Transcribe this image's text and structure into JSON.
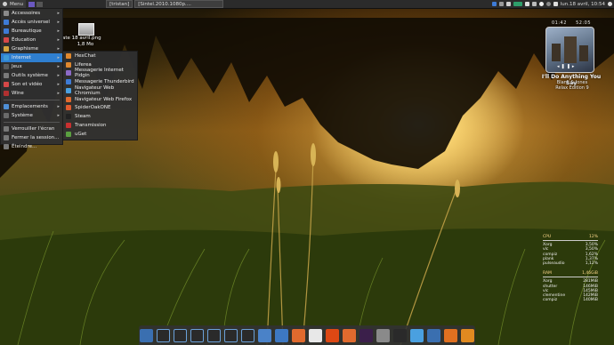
{
  "top_panel": {
    "menu_label": "Menu",
    "windows": [
      "[tristan]",
      "[Sintel.2010.1080p...."
    ],
    "clock": "lun.18 avril, 10:54"
  },
  "menu": {
    "categories": [
      {
        "label": "Accessoires",
        "icon": "accessories-icon",
        "color": "#8a8a8a"
      },
      {
        "label": "Accès universel",
        "icon": "accessibility-icon",
        "color": "#3e7bd6"
      },
      {
        "label": "Bureautique",
        "icon": "office-icon",
        "color": "#3e7bd6"
      },
      {
        "label": "Éducation",
        "icon": "education-icon",
        "color": "#d64848"
      },
      {
        "label": "Graphisme",
        "icon": "graphics-icon",
        "color": "#d6a63e"
      },
      {
        "label": "Internet",
        "icon": "internet-icon",
        "color": "#3e9bd6"
      },
      {
        "label": "Jeux",
        "icon": "games-icon",
        "color": "#5a5a5a"
      },
      {
        "label": "Outils système",
        "icon": "system-tools-icon",
        "color": "#7a7a7a"
      },
      {
        "label": "Son et vidéo",
        "icon": "multimedia-icon",
        "color": "#d64848"
      },
      {
        "label": "Wine",
        "icon": "wine-icon",
        "color": "#b03030"
      }
    ],
    "places": [
      {
        "label": "Emplacements",
        "icon": "places-icon",
        "color": "#4f8fd6"
      },
      {
        "label": "Système",
        "icon": "system-icon",
        "color": "#6a6a6a"
      }
    ],
    "actions": [
      {
        "label": "Verrouiller l'écran",
        "icon": "lock-icon"
      },
      {
        "label": "Fermer la session...",
        "icon": "logout-icon"
      },
      {
        "label": "Éteindre...",
        "icon": "power-icon"
      }
    ]
  },
  "submenu": {
    "items": [
      {
        "label": "HexChat",
        "icon": "hexchat-icon",
        "color": "#e0882e"
      },
      {
        "label": "Liferea",
        "icon": "liferea-icon",
        "color": "#e0882e"
      },
      {
        "label": "Messagerie Internet Pidgin",
        "icon": "pidgin-icon",
        "color": "#8c6ac8"
      },
      {
        "label": "Messagerie Thunderbird",
        "icon": "thunderbird-icon",
        "color": "#3e7bd6"
      },
      {
        "label": "Navigateur Web Chromium",
        "icon": "chromium-icon",
        "color": "#4aa0e0"
      },
      {
        "label": "Navigateur Web Firefox",
        "icon": "firefox-icon",
        "color": "#e06a2e"
      },
      {
        "label": "SpiderOakONE",
        "icon": "spideroak-icon",
        "color": "#e05a2e"
      },
      {
        "label": "Steam",
        "icon": "steam-icon",
        "color": "#222222"
      },
      {
        "label": "Transmission",
        "icon": "transmission-icon",
        "color": "#c83030"
      },
      {
        "label": "uGet",
        "icon": "uget-icon",
        "color": "#5aa040"
      }
    ]
  },
  "desktop": {
    "file_label": "ate 18 avril.png",
    "file_size": "1,8 Mo"
  },
  "media_widget": {
    "time_elapsed": "01:42",
    "time_total": "52:05",
    "track": "I'll Do Anything You Say",
    "artist_line1": "Blank & Jones",
    "artist_line2": "Relax Edition 9"
  },
  "conky": {
    "cpu_label": "CPU",
    "cpu_value": "12%",
    "cpu_procs": [
      {
        "name": "Xorg",
        "value": "3,50%"
      },
      {
        "name": "vlc",
        "value": "3,50%"
      },
      {
        "name": "compiz",
        "value": "1,62%"
      },
      {
        "name": "plank",
        "value": "1,37%"
      },
      {
        "name": "pulseaudio",
        "value": "1,12%"
      }
    ],
    "ram_label": "RAM",
    "ram_value": "1,46GiB",
    "ram_procs": [
      {
        "name": "Xorg",
        "value": "281MiB"
      },
      {
        "name": "shutter",
        "value": "146MiB"
      },
      {
        "name": "vlc",
        "value": "145MiB"
      },
      {
        "name": "clementine",
        "value": "142MiB"
      },
      {
        "name": "compiz",
        "value": "140MiB"
      }
    ]
  },
  "dock": {
    "items": [
      {
        "icon": "anchor-icon",
        "color": "#3a6fb0"
      },
      {
        "icon": "workspace-icon",
        "color": "#2a2a2a"
      },
      {
        "icon": "workspace-icon",
        "color": "#2a2a2a"
      },
      {
        "icon": "workspace-icon",
        "color": "#2a2a2a"
      },
      {
        "icon": "workspace-icon",
        "color": "#2a2a2a"
      },
      {
        "icon": "workspace-icon",
        "color": "#2a2a2a"
      },
      {
        "icon": "workspace-icon",
        "color": "#2a2a2a"
      },
      {
        "icon": "folder-icon",
        "color": "#4a82c8"
      },
      {
        "icon": "home-folder-icon",
        "color": "#3d78c2"
      },
      {
        "icon": "firefox-icon",
        "color": "#e06a2e"
      },
      {
        "icon": "text-editor-icon",
        "color": "#e8e8e8"
      },
      {
        "icon": "ubuntu-icon",
        "color": "#dd4814"
      },
      {
        "icon": "ubuntu-software-icon",
        "color": "#e06a2e"
      },
      {
        "icon": "terminal-icon",
        "color": "#3b1f4a"
      },
      {
        "icon": "image-viewer-icon",
        "color": "#8a8a8a"
      },
      {
        "icon": "search-icon",
        "color": "#2a2a2a"
      },
      {
        "icon": "screenshot-icon",
        "color": "#4aa0e0"
      },
      {
        "icon": "camera-icon",
        "color": "#3a6fb0"
      },
      {
        "icon": "music-player-icon",
        "color": "#e07020"
      },
      {
        "icon": "vlc-icon",
        "color": "#e08a20"
      }
    ]
  }
}
